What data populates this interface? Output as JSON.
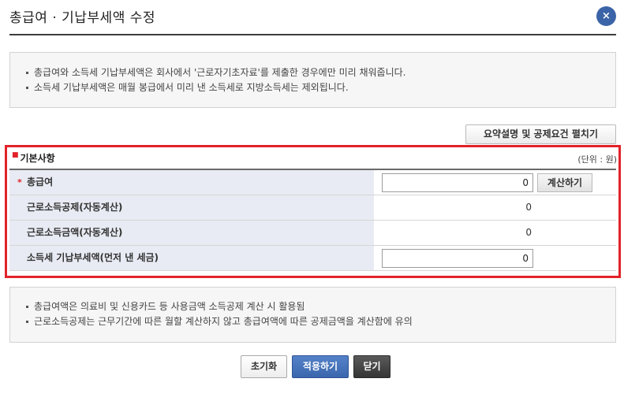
{
  "dialog": {
    "title": "총급여 · 기납부세액 수정",
    "close_icon": "×"
  },
  "info_top": {
    "lines": [
      "총급여와 소득세 기납부세액은 회사에서 '근로자기초자료'를 제출한 경우에만 미리 채워줍니다.",
      "소득세 기납부세액은 매월 봉급에서 미리 낸 소득세로 지방소득세는 제외됩니다."
    ]
  },
  "toggle_button": "요약설명 및 공제요건 펼치기",
  "basic": {
    "title": "기본사항",
    "unit": "(단위 : 원)",
    "rows": [
      {
        "label": "총급여",
        "required": "*",
        "value": "0",
        "button": "계산하기"
      },
      {
        "label": "근로소득공제(자동계산)",
        "value": "0"
      },
      {
        "label": "근로소득금액(자동계산)",
        "value": "0"
      },
      {
        "label": "소득세 기납부세액(먼저 낸 세금)",
        "value": "0"
      }
    ]
  },
  "info_bottom": {
    "lines": [
      "총급여액은 의료비 및 신용카드 등 사용금액 소득공제 계산 시 활용됨",
      "근로소득공제는 근무기간에 따른 월할 계산하지 않고 총급여액에 따른 공제금액을 계산함에 유의"
    ]
  },
  "buttons": {
    "reset": "초기화",
    "apply": "적용하기",
    "close": "닫기"
  },
  "colors": {
    "accent": "#3b64a8",
    "highlight_border": "#e2222a",
    "label_bg": "#e8ebf3"
  }
}
